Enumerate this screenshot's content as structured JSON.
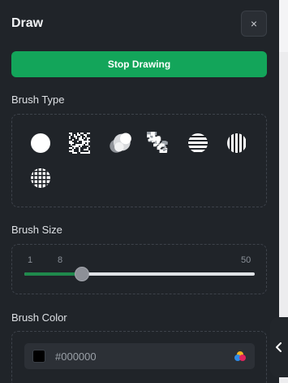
{
  "panel": {
    "title": "Draw",
    "close_label": "×",
    "stop_button_label": "Stop Drawing",
    "accent_color": "#13a55a"
  },
  "brush_type": {
    "label": "Brush Type",
    "brushes": [
      {
        "name": "round",
        "icon": "solid-circle-icon"
      },
      {
        "name": "noise",
        "icon": "noise-square-icon"
      },
      {
        "name": "cloud",
        "icon": "cloud-icon"
      },
      {
        "name": "spray",
        "icon": "spray-icon"
      },
      {
        "name": "horizontal-lines",
        "icon": "horizontal-lines-icon"
      },
      {
        "name": "vertical-lines",
        "icon": "vertical-lines-icon"
      },
      {
        "name": "grid",
        "icon": "grid-circle-icon"
      }
    ]
  },
  "brush_size": {
    "label": "Brush Size",
    "min": "1",
    "current": "8",
    "max": "50",
    "value": 8
  },
  "brush_color": {
    "label": "Brush Color",
    "value": "#000000",
    "swatch_color": "#000000"
  }
}
